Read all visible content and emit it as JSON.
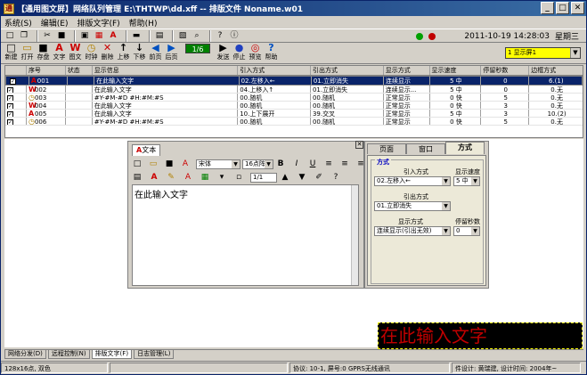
{
  "window": {
    "title": "【通用图文屏】网络队列管理 E:\\THTWP\\dd.xff -- 排版文件 Noname.w01"
  },
  "menu": [
    "系统(S)",
    "编辑(E)",
    "排版文字(F)",
    "帮助(H)"
  ],
  "statusbar_top": {
    "datetime": "2011-10-19 14:28:03",
    "weekday": "星期三"
  },
  "toolbar": [
    {
      "name": "new",
      "label": "新建",
      "glyph": "□"
    },
    {
      "name": "open",
      "label": "打开",
      "glyph": "▭"
    },
    {
      "name": "save",
      "label": "存盘",
      "glyph": "■"
    },
    {
      "name": "text",
      "label": "文字",
      "glyph": "A"
    },
    {
      "name": "image",
      "label": "图文",
      "glyph": "W"
    },
    {
      "name": "clock",
      "label": "时钟",
      "glyph": "◷"
    },
    {
      "name": "delete",
      "label": "删除",
      "glyph": "✕"
    },
    {
      "name": "up",
      "label": "上移",
      "glyph": "↑"
    },
    {
      "name": "down",
      "label": "下移",
      "glyph": "↓"
    },
    {
      "name": "prev",
      "label": "前页",
      "glyph": "◀"
    },
    {
      "name": "next",
      "label": "后页",
      "glyph": "▶"
    }
  ],
  "page_indicator": "1/6",
  "toolbar2": [
    {
      "name": "send",
      "label": "发送",
      "glyph": "▶"
    },
    {
      "name": "stop",
      "label": "停止",
      "glyph": "●"
    },
    {
      "name": "preview",
      "label": "预览",
      "glyph": "◎"
    },
    {
      "name": "help",
      "label": "帮助",
      "glyph": "?"
    }
  ],
  "screen_select": "1 显示屏1",
  "table": {
    "headers": [
      "序号",
      "状态",
      "显示信息",
      "引入方式",
      "引出方式",
      "显示方式",
      "显示速度",
      "停留秒数",
      "边框方式"
    ],
    "rows": [
      {
        "kind": "A",
        "id": "001",
        "status": "",
        "info": "在此输入文字",
        "in": "02.左移入←",
        "out": "01.立即消失",
        "mode": "连续显示",
        "speed": "5 中",
        "stay": "0",
        "border": "6.(1)",
        "selected": true
      },
      {
        "kind": "W",
        "id": "002",
        "status": "",
        "info": "在此输入文字",
        "in": "04.上移入↑",
        "out": "01.立即消失",
        "mode": "连续显示...",
        "speed": "5 中",
        "stay": "0",
        "border": "0.无",
        "selected": false
      },
      {
        "kind": "◷",
        "id": "003",
        "status": "",
        "info": "#Y-#M-#D #H:#M:#S",
        "in": "00.随机",
        "out": "00.随机",
        "mode": "正常显示",
        "speed": "0 快",
        "stay": "5",
        "border": "0.无",
        "selected": false
      },
      {
        "kind": "W",
        "id": "004",
        "status": "",
        "info": "在此输入文字",
        "in": "00.随机",
        "out": "00.随机",
        "mode": "正常显示",
        "speed": "0 快",
        "stay": "3",
        "border": "0.无",
        "selected": false
      },
      {
        "kind": "A",
        "id": "005",
        "status": "",
        "info": "在此输入文字",
        "in": "10.上下展开",
        "out": "39.交叉",
        "mode": "正常显示",
        "speed": "5 中",
        "stay": "3",
        "border": "10.(2)",
        "selected": false
      },
      {
        "kind": "◷",
        "id": "006",
        "status": "",
        "info": "#Y-#M-#D #H:#M:#S",
        "in": "00.随机",
        "out": "00.随机",
        "mode": "正常显示",
        "speed": "0 快",
        "stay": "5",
        "border": "0.无",
        "selected": false
      }
    ]
  },
  "editor": {
    "tab": "文本",
    "font": "宋体",
    "size": "16点阵",
    "page": "1/1",
    "content": "在此输入文字"
  },
  "props": {
    "tabs": [
      "页面",
      "窗口",
      "方式"
    ],
    "group": "方式",
    "in_label": "引入方式",
    "in_value": "02.左移入←",
    "speed_label": "显示速度",
    "speed_value": "5 中",
    "out_label": "引出方式",
    "out_value": "01.立即消失",
    "mode_label": "显示方式",
    "mode_value": "连续显示(引出无效)",
    "stay_label": "停留秒数",
    "stay_value": "0"
  },
  "preview_text": "在此输入文字",
  "bottom_tabs": [
    "网络分发(D)",
    "远程控制(N)",
    "排版文字(F)",
    "日志管理(L)"
  ],
  "status": {
    "size": "128x16点, 双色",
    "protocol": "协议: 10-1, 屏号:0 GPRS无线通讯",
    "designer": "件设计: 黄瑞建, 设计时间: 2004年~"
  },
  "colors": {
    "title": "#0a246a",
    "selection": "#0a246a",
    "led_red": "#c00000"
  }
}
